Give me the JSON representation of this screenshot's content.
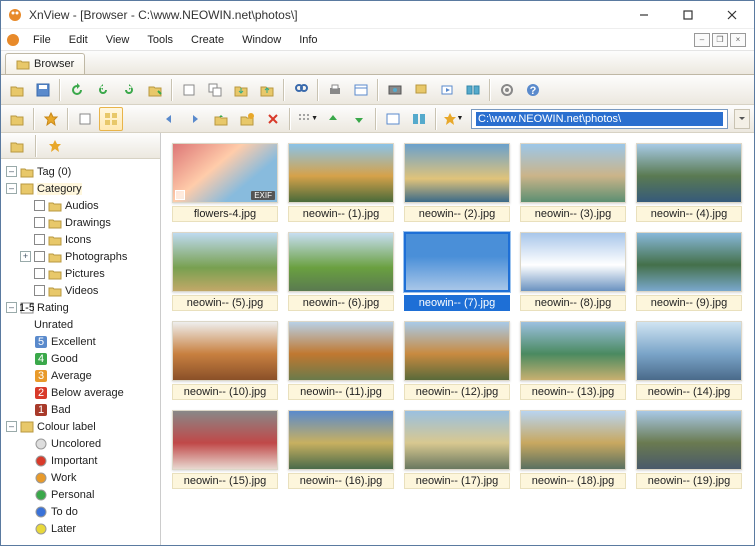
{
  "title": "XnView - [Browser - C:\\www.NEOWIN.net\\photos\\]",
  "menu": {
    "file": "File",
    "edit": "Edit",
    "view": "View",
    "tools": "Tools",
    "create": "Create",
    "window": "Window",
    "info": "Info"
  },
  "tab": {
    "label": "Browser"
  },
  "address": "C:\\www.NEOWIN.net\\photos\\",
  "tree": {
    "tag": "Tag (0)",
    "category": "Category",
    "cat_items": [
      "Audios",
      "Drawings",
      "Icons",
      "Photographs",
      "Pictures",
      "Videos"
    ],
    "rating": "Rating",
    "ratings": [
      "Unrated",
      "Excellent",
      "Good",
      "Average",
      "Below average",
      "Bad"
    ],
    "rating_nums": [
      "",
      "5",
      "4",
      "3",
      "2",
      "1"
    ],
    "colour": "Colour label",
    "colours": [
      "Uncolored",
      "Important",
      "Work",
      "Personal",
      "To do",
      "Later"
    ],
    "colour_hex": [
      "#ddd",
      "#d83a2a",
      "#e89a2a",
      "#3aa84a",
      "#3a72d8",
      "#e8d83a"
    ]
  },
  "thumbs": [
    {
      "label": "flowers-4.jpg",
      "g": "g1",
      "exif": true
    },
    {
      "label": "neowin-- (1).jpg",
      "g": "g2"
    },
    {
      "label": "neowin-- (2).jpg",
      "g": "g3"
    },
    {
      "label": "neowin-- (3).jpg",
      "g": "g4"
    },
    {
      "label": "neowin-- (4).jpg",
      "g": "g5"
    },
    {
      "label": "neowin-- (5).jpg",
      "g": "g6"
    },
    {
      "label": "neowin-- (6).jpg",
      "g": "g7"
    },
    {
      "label": "neowin-- (7).jpg",
      "g": "g8",
      "selected": true
    },
    {
      "label": "neowin-- (8).jpg",
      "g": "g9"
    },
    {
      "label": "neowin-- (9).jpg",
      "g": "g10"
    },
    {
      "label": "neowin-- (10).jpg",
      "g": "g11"
    },
    {
      "label": "neowin-- (11).jpg",
      "g": "g12"
    },
    {
      "label": "neowin-- (12).jpg",
      "g": "g13"
    },
    {
      "label": "neowin-- (13).jpg",
      "g": "g14"
    },
    {
      "label": "neowin-- (14).jpg",
      "g": "g15"
    },
    {
      "label": "neowin-- (15).jpg",
      "g": "g16"
    },
    {
      "label": "neowin-- (16).jpg",
      "g": "g17"
    },
    {
      "label": "neowin-- (17).jpg",
      "g": "g18"
    },
    {
      "label": "neowin-- (18).jpg",
      "g": "g19"
    },
    {
      "label": "neowin-- (19).jpg",
      "g": "g20"
    }
  ],
  "exif_badge": "EXIF"
}
